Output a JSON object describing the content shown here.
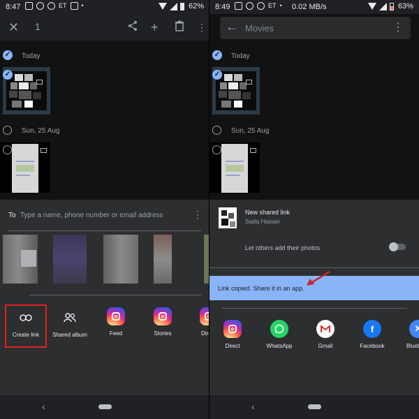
{
  "left": {
    "status": {
      "time": "8:47",
      "icons": [
        "photo-icon",
        "whatsapp-icon",
        "whatsapp-icon",
        "ET",
        "dnd-icon",
        "•"
      ],
      "battery": "62%"
    },
    "toolbar": {
      "count": "1"
    },
    "sections": [
      {
        "label": "Today",
        "selected": true
      },
      {
        "label": "Sun, 25 Aug",
        "selected": false
      }
    ],
    "share": {
      "to_label": "To",
      "to_placeholder": "Type a name, phone number or email address",
      "apps": [
        {
          "label": "Create link",
          "icon": "link-icon"
        },
        {
          "label": "Shared album",
          "icon": "people-icon"
        },
        {
          "label": "Feed",
          "icon": "instagram-icon"
        },
        {
          "label": "Stories",
          "icon": "instagram-icon"
        },
        {
          "label": "Dire",
          "icon": "instagram-icon"
        }
      ]
    }
  },
  "right": {
    "status": {
      "time": "8:49",
      "icons": [
        "photo-icon",
        "whatsapp-icon",
        "whatsapp-icon",
        "ET",
        "•"
      ],
      "net": "0.02 MB/s",
      "battery": "63%"
    },
    "search": {
      "placeholder": "Movies"
    },
    "sections": [
      {
        "label": "Today",
        "selected": true
      },
      {
        "label": "Sun, 25 Aug",
        "selected": false
      }
    ],
    "shared_link": {
      "title": "New shared link",
      "owner": "Sadiq Hassan"
    },
    "toggle_label": "Let others add their photos",
    "banner": "Link copied. Share it in an app.",
    "apps": [
      {
        "label": "Direct",
        "icon": "instagram-icon",
        "color": "#d6249f"
      },
      {
        "label": "WhatsApp",
        "icon": "whatsapp-icon",
        "color": "#25d366"
      },
      {
        "label": "Gmail",
        "icon": "gmail-icon",
        "color": "#d93025"
      },
      {
        "label": "Facebook",
        "icon": "facebook-icon",
        "color": "#1877f2"
      },
      {
        "label": "Blueto",
        "icon": "bluetooth-icon",
        "color": "#4285f4"
      }
    ]
  },
  "colors": {
    "accent": "#8ab4f8",
    "highlight": "#e02020",
    "sheet": "#2d2e30",
    "background": "#121212"
  }
}
